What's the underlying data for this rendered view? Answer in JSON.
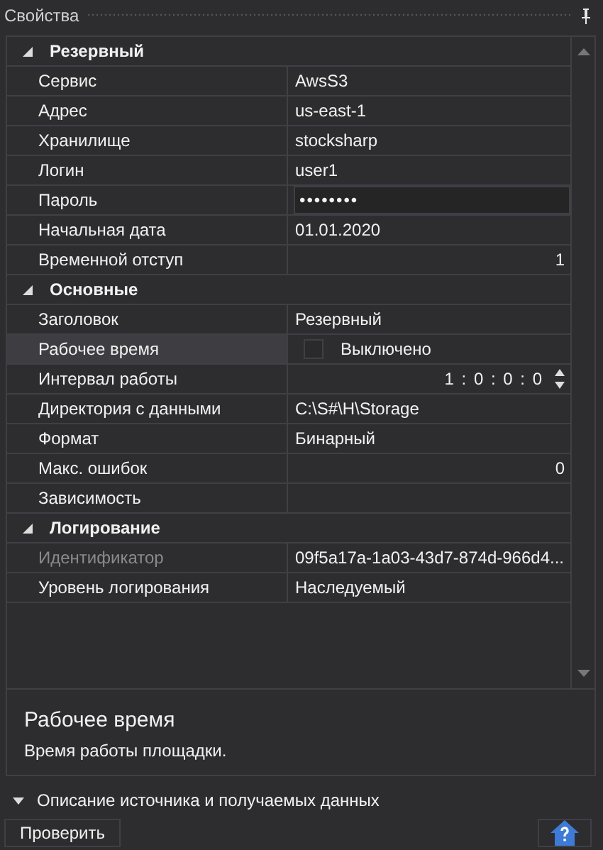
{
  "panel": {
    "title": "Свойства"
  },
  "categories": [
    {
      "label": "Резервный",
      "expanded": true,
      "rows": [
        {
          "label": "Сервис",
          "kind": "text",
          "value": "AwsS3",
          "selected": false,
          "disabled": false
        },
        {
          "label": "Адрес",
          "kind": "text",
          "value": "us-east-1",
          "selected": false,
          "disabled": false
        },
        {
          "label": "Хранилище",
          "kind": "text",
          "value": "stocksharp",
          "selected": false,
          "disabled": false
        },
        {
          "label": "Логин",
          "kind": "text",
          "value": "user1",
          "selected": false,
          "disabled": false
        },
        {
          "label": "Пароль",
          "kind": "password",
          "value": "••••••••",
          "selected": false,
          "disabled": false
        },
        {
          "label": "Начальная дата",
          "kind": "text",
          "value": "01.01.2020",
          "selected": false,
          "disabled": false
        },
        {
          "label": "Временной отступ",
          "kind": "number",
          "value": "1",
          "selected": false,
          "disabled": false
        }
      ]
    },
    {
      "label": "Основные",
      "expanded": true,
      "rows": [
        {
          "label": "Заголовок",
          "kind": "text",
          "value": "Резервный",
          "selected": false,
          "disabled": false
        },
        {
          "label": "Рабочее время",
          "kind": "checkbox",
          "value": "Выключено",
          "checked": false,
          "selected": true,
          "disabled": false
        },
        {
          "label": "Интервал работы",
          "kind": "spinner",
          "value": "1 : 0 : 0 : 0",
          "selected": false,
          "disabled": false
        },
        {
          "label": "Директория с данными",
          "kind": "text",
          "value": "C:\\S#\\H\\Storage",
          "selected": false,
          "disabled": false
        },
        {
          "label": "Формат",
          "kind": "text",
          "value": "Бинарный",
          "selected": false,
          "disabled": false
        },
        {
          "label": "Макс. ошибок",
          "kind": "number",
          "value": "0",
          "selected": false,
          "disabled": false
        },
        {
          "label": "Зависимость",
          "kind": "empty",
          "selected": false,
          "disabled": false
        }
      ]
    },
    {
      "label": "Логирование",
      "expanded": true,
      "rows": [
        {
          "label": "Идентификатор",
          "kind": "text",
          "value": "09f5a17a-1a03-43d7-874d-966d4...",
          "selected": false,
          "disabled": true
        },
        {
          "label": "Уровень логирования",
          "kind": "text",
          "value": "Наследуемый",
          "selected": false,
          "disabled": false
        }
      ]
    }
  ],
  "description": {
    "title": "Рабочее время",
    "text": "Время работы площадки."
  },
  "expander": {
    "label": "Описание источника и получаемых данных",
    "expanded": false
  },
  "buttons": {
    "check": "Проверить"
  }
}
